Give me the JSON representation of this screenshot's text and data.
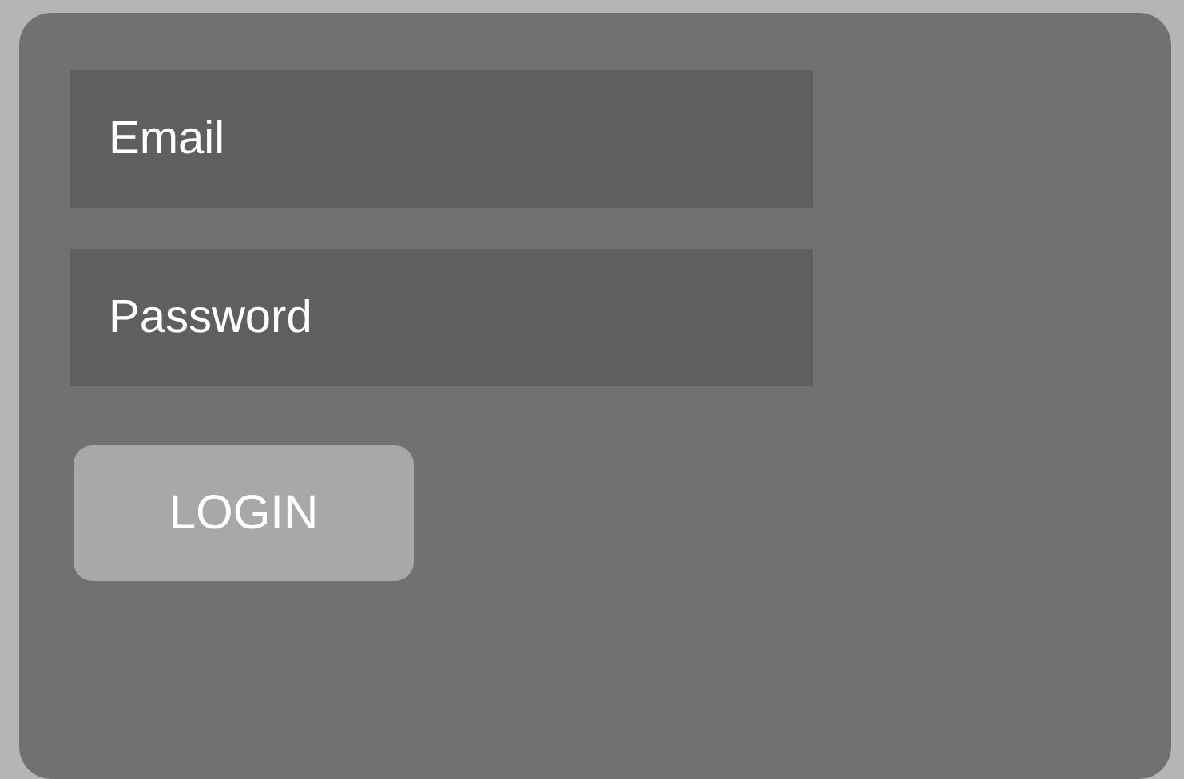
{
  "form": {
    "fields": [
      {
        "placeholder": "Email"
      },
      {
        "placeholder": "Password"
      }
    ],
    "button": "LOGIN"
  }
}
